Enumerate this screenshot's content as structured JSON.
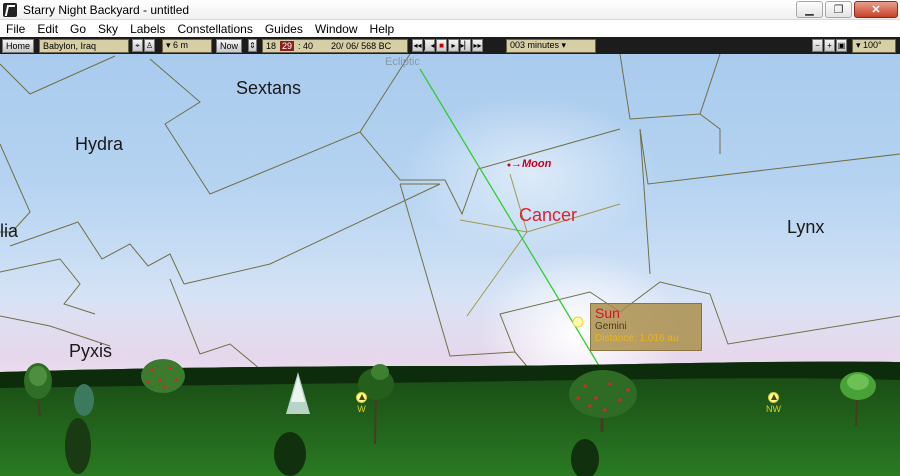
{
  "window": {
    "title": "Starry Night Backyard - untitled"
  },
  "menu": [
    "File",
    "Edit",
    "Go",
    "Sky",
    "Labels",
    "Constellations",
    "Guides",
    "Window",
    "Help"
  ],
  "toolbar": {
    "home_label": "Home",
    "location": "Babylon, Iraq",
    "elevation": "▾ 6 m",
    "now_label": "Now",
    "time_hour": "18",
    "time_min": "29",
    "time_sec": ": 40",
    "date": "20/ 06/  568 BC",
    "time_step": "003 minutes ▾",
    "fov": "▾ 100°"
  },
  "sky": {
    "ecliptic_label": "Ecliptic",
    "constellations": {
      "sextans": "Sextans",
      "hydra": "Hydra",
      "lia": "lia",
      "lynx": "Lynx",
      "pyxis": "Pyxis",
      "cancer": "Cancer"
    },
    "moon_label": "→Moon",
    "sun_info": {
      "name": "Sun",
      "constellation": "Gemini",
      "distance": "Distance: 1.016 au"
    },
    "compass": {
      "west": "W",
      "northwest": "NW"
    }
  },
  "colors": {
    "ground": "#1f5a1a",
    "horizon_dark": "#0c2a0a",
    "boundary": "#707048",
    "constellation_line": "#a09850",
    "ecliptic": "#33cc33"
  }
}
